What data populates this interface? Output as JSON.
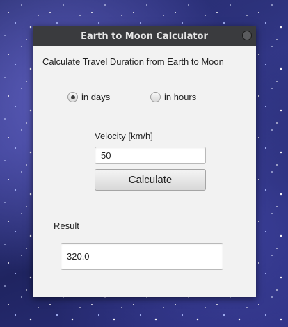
{
  "window": {
    "title": "Earth to Moon Calculator"
  },
  "main": {
    "heading": "Calculate Travel Duration from Earth to Moon",
    "unit_options": [
      {
        "label": "in days",
        "checked": true
      },
      {
        "label": "in hours",
        "checked": false
      }
    ],
    "velocity_label": "Velocity [km/h]",
    "velocity_value": "50",
    "calculate_label": "Calculate",
    "result_label": "Result",
    "result_value": "320.0"
  },
  "colors": {
    "titlebar": "#3a3b3e",
    "window_bg": "#f2f2f2",
    "desktop": "#2d3080"
  }
}
